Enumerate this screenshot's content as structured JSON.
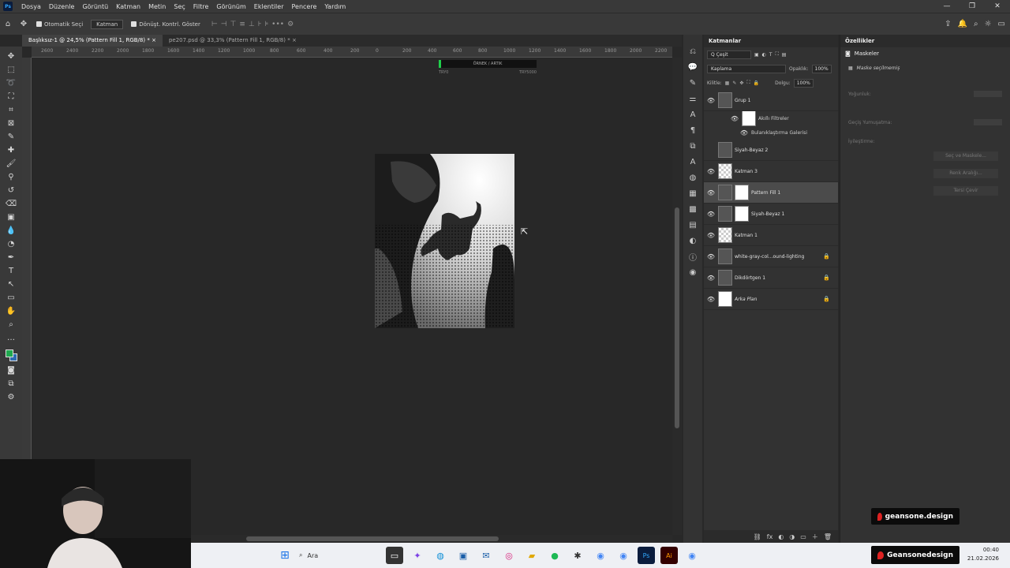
{
  "menubar": {
    "logo": "Ps",
    "items": [
      "Dosya",
      "Düzenle",
      "Görüntü",
      "Katman",
      "Metin",
      "Seç",
      "Filtre",
      "Görünüm",
      "Eklentiler",
      "Pencere",
      "Yardım"
    ],
    "window_controls": [
      "—",
      "❐",
      "✕"
    ]
  },
  "options": {
    "auto_select_label": "Otomatik Seçi",
    "auto_select_target": "Katman",
    "transform_label": "Dönüşt. Kontrl. Göster"
  },
  "tabs": [
    {
      "label": "Başlıksız-1 @ 24,5% (Pattern Fill 1, RGB/8) *",
      "close": "×"
    },
    {
      "label": "pe207.psd @ 33,3% (Pattern Fill 1, RGB/8) *",
      "close": "×"
    }
  ],
  "ruler": [
    "2600",
    "2400",
    "2200",
    "2000",
    "1800",
    "1600",
    "1400",
    "1200",
    "1000",
    "800",
    "600",
    "400",
    "200",
    "0",
    "200",
    "400",
    "600",
    "800",
    "1000",
    "1200",
    "1400",
    "1600",
    "1800",
    "2000",
    "2200"
  ],
  "overlay": {
    "bar_text": "ÖRNEK / ARTIK",
    "left": "TRY0",
    "right": "TRY5000"
  },
  "layers_panel": {
    "title": "Katmanlar",
    "filter_label": "Q Çeşit",
    "blend_mode": "Kaplama",
    "opacity_label": "Opaklık:",
    "opacity_value": "100%",
    "lock_label": "Kilitle:",
    "fill_label": "Dolgu:",
    "fill_value": "100%",
    "layers": [
      {
        "name": "Grup 1",
        "visible": true,
        "thumb": "dark"
      },
      {
        "name": "Akıllı Filtreler",
        "visible": true,
        "thumb": "white",
        "sub": true
      },
      {
        "name": "Bulanıklaştırma Galerisi",
        "visible": true,
        "sub": true
      },
      {
        "name": "Siyah-Beyaz 2",
        "visible": false,
        "thumb": "dark"
      },
      {
        "name": "Katman 3",
        "visible": true,
        "thumb": "check"
      },
      {
        "name": "Pattern Fill 1",
        "visible": true,
        "thumb": "dark",
        "selected": true
      },
      {
        "name": "Siyah-Beyaz 1",
        "visible": true,
        "thumb": "dark"
      },
      {
        "name": "Katman 1",
        "visible": true,
        "thumb": "check"
      },
      {
        "name": "white-gray-col...ound-lighting",
        "visible": true,
        "thumb": "dark",
        "locked": true
      },
      {
        "name": "Dikdörtgen 1",
        "visible": true,
        "thumb": "dark",
        "locked": true
      },
      {
        "name": "Arka Plan",
        "visible": true,
        "thumb": "white",
        "locked": true,
        "italic": true
      }
    ],
    "footer_icons": [
      "⛓",
      "fx",
      "◐",
      "◑",
      "▭",
      "＋",
      "🗑"
    ]
  },
  "properties_panel": {
    "title": "Özellikler",
    "tab": "Maskeler",
    "subtitle": "Maske seçilmemiş",
    "density_label": "Yoğunluk:",
    "feather_label": "Geçiş Yumuşatma:",
    "refine_label": "İyileştirme:",
    "buttons": [
      "Seç ve Maskele...",
      "Renk Aralığı...",
      "Tersi Çevir"
    ]
  },
  "badges": {
    "top": "geansone.design",
    "bottom": "Geansonedesign"
  },
  "taskbar": {
    "search_placeholder": "Ara",
    "time": "00:40",
    "date": "21.02.2026"
  }
}
